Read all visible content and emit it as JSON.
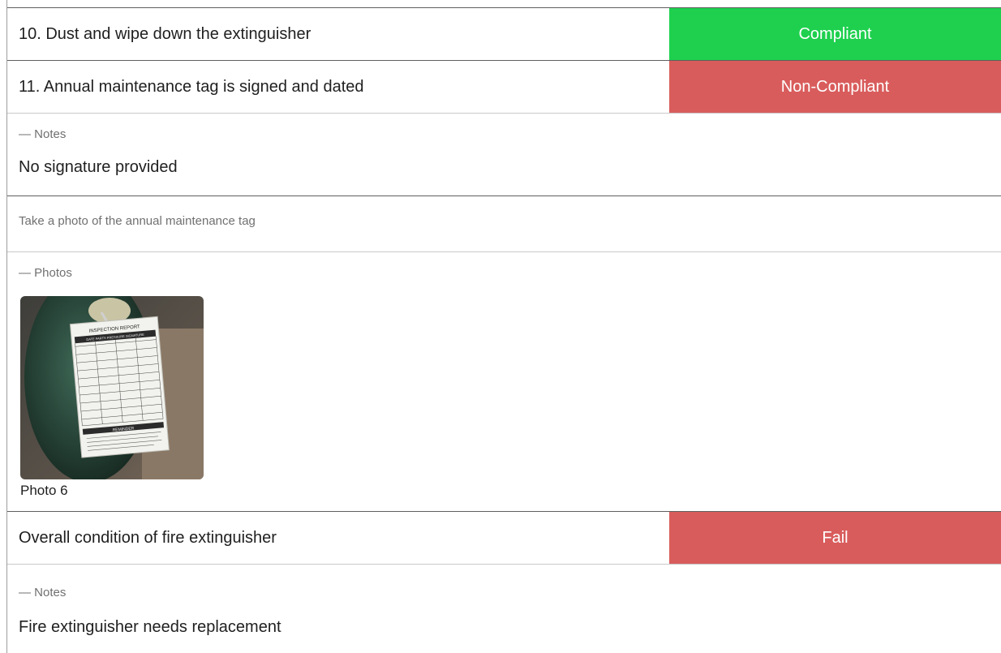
{
  "items": [
    {
      "label": "10. Dust and wipe down the extinguisher",
      "status": "Compliant",
      "status_color": "#1ed04e"
    },
    {
      "label": "11. Annual maintenance tag is signed and dated",
      "status": "Non-Compliant",
      "status_color": "#d95c5c"
    }
  ],
  "notes_1": {
    "label": "— Notes",
    "text": "No signature provided"
  },
  "photo_instruction": "Take a photo of the annual maintenance tag",
  "photos": {
    "label": "— Photos",
    "items": [
      {
        "caption": "Photo 6",
        "tag_title": "INSPECTION REPORT",
        "tag_columns": "DATE  PARTS  PRESSURE  SIGNATURE",
        "tag_footer": "REMINDER"
      }
    ]
  },
  "overall": {
    "label": "Overall condition of fire extinguisher",
    "status": "Fail",
    "status_color": "#d95c5c"
  },
  "notes_2": {
    "label": "— Notes",
    "text": "Fire extinguisher needs replacement"
  }
}
